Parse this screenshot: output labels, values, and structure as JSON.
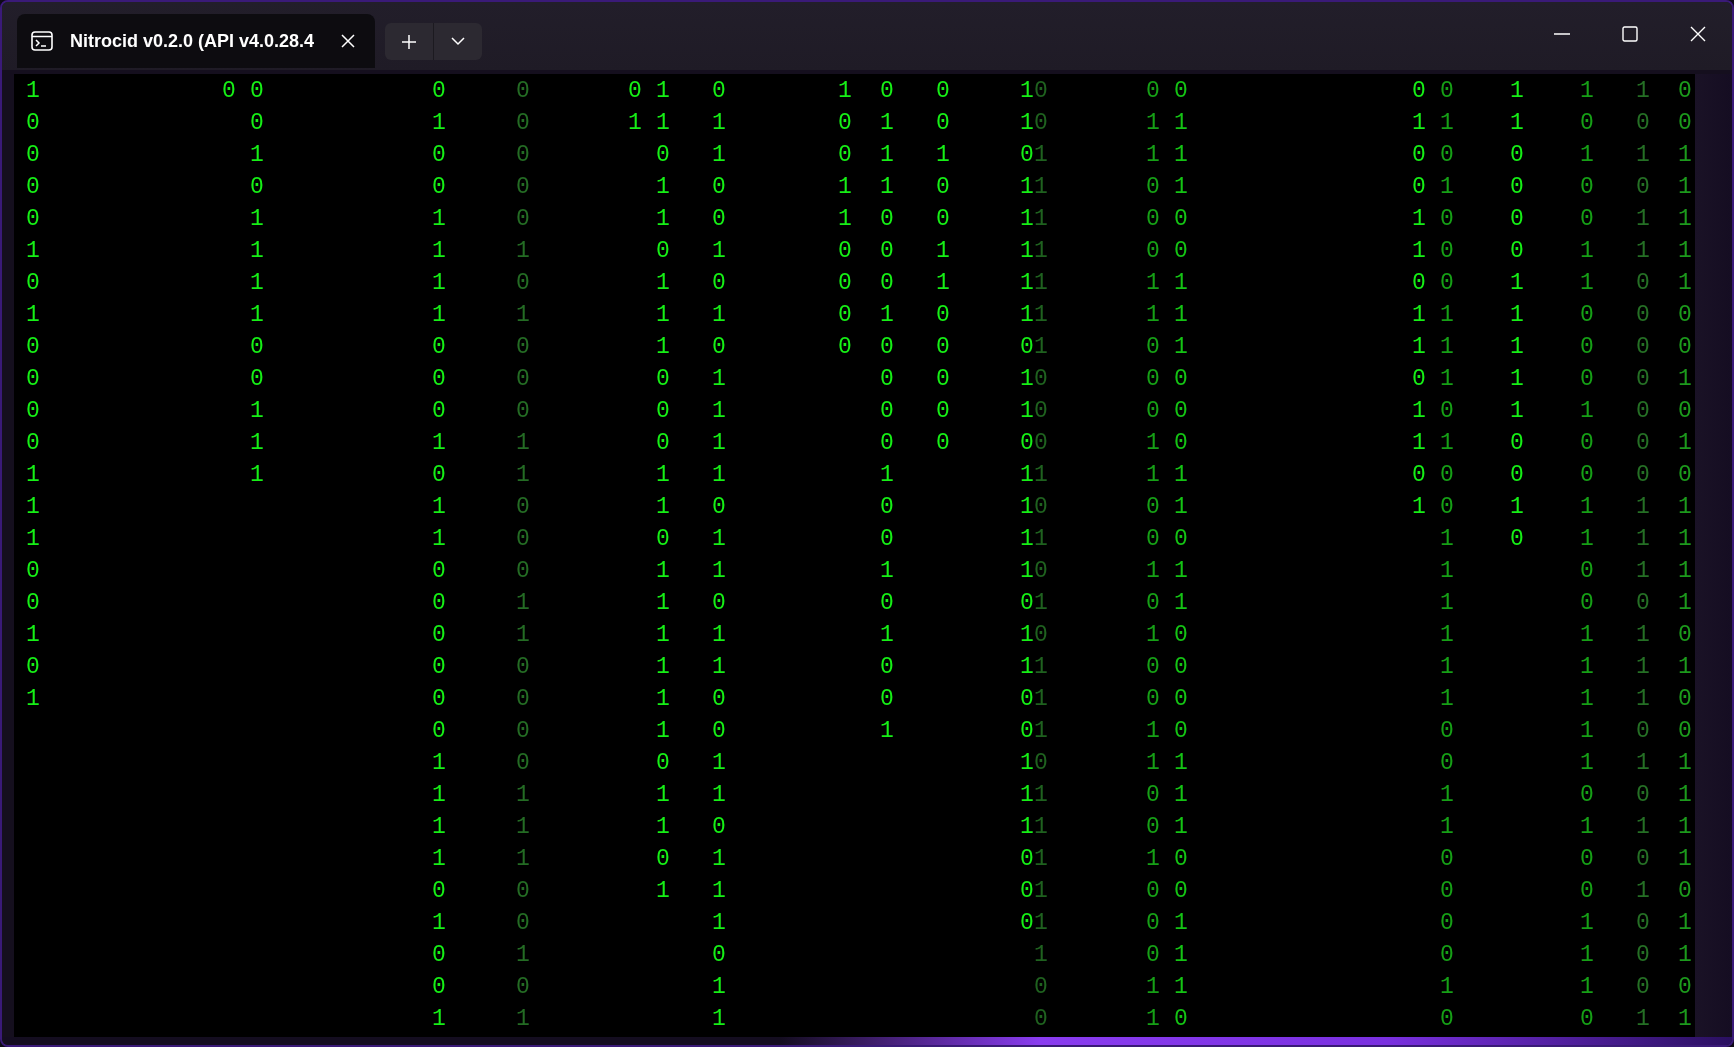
{
  "window": {
    "tab": {
      "title": "Nitrocid v0.2.0 (API v4.0.28.4",
      "selected": true
    }
  },
  "terminal": {
    "columns": [
      {
        "color": "#16f016",
        "digits": "10000101000011100101"
      },
      {
        "color": "#16f016",
        "digits": "0"
      },
      {
        "color": "#16f016",
        "digits": "0010111100111"
      },
      {
        "color": "#16f016",
        "digits": "010011110001011000000111101001"
      },
      {
        "color": "#246c24",
        "digits": "000001010001100011000011100101"
      },
      {
        "color": "#16f016",
        "digits": "01"
      },
      {
        "color": "#16f016",
        "digits": "11011011100011011111101101"
      },
      {
        "color": "#16f016",
        "digits": "011001010111101101100110111011"
      },
      {
        "color": "#16f016",
        "digits": "100110000"
      },
      {
        "color": "#16f016",
        "digits": "011100010000100101001"
      },
      {
        "color": "#16f016",
        "digits": "001001100000"
      },
      {
        "color": "#16f016",
        "digits": "110111110110111101100111000"
      },
      {
        "color": "#1f621f",
        "digits": "001111111000101010111011111100"
      },
      {
        "color": "#16a016",
        "digits": "011000110001100101001100100011"
      },
      {
        "color": "#14c414",
        "digits": "011100111000110110000111001110"
      },
      {
        "color": "#16f016",
        "digits": "01001101101101"
      },
      {
        "color": "#16a016",
        "digits": "010100011101001111110011000010"
      },
      {
        "color": "#16f016",
        "digits": "110000111110010"
      },
      {
        "color": "#16a016",
        "digits": "101001100010011001111101001110"
      },
      {
        "color": "#257025",
        "digits": "101011000000011101110101010001"
      },
      {
        "color": "#1c9a1c",
        "digits": "001111100101011110100111101101"
      }
    ]
  }
}
